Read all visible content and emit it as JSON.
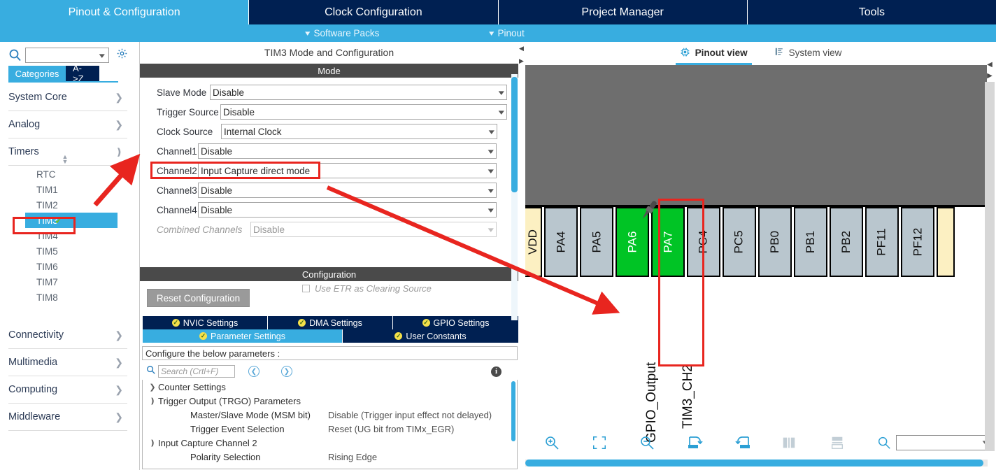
{
  "top_tabs": [
    {
      "label": "Pinout & Configuration",
      "active": true
    },
    {
      "label": "Clock Configuration",
      "active": false
    },
    {
      "label": "Project Manager",
      "active": false
    },
    {
      "label": "Tools",
      "active": false
    }
  ],
  "sub_bar": {
    "software_packs": "Software Packs",
    "pinout": "Pinout"
  },
  "sidebar": {
    "search_value": "",
    "search_icon": "search-icon",
    "gear_icon": "gear-icon",
    "toggle": {
      "categories": "Categories",
      "a_to_z": "A->Z"
    },
    "categories": [
      {
        "label": "System Core",
        "expanded": false
      },
      {
        "label": "Analog",
        "expanded": false
      },
      {
        "label": "Timers",
        "expanded": true
      }
    ],
    "timers": [
      {
        "label": "RTC",
        "selected": false,
        "configured": false
      },
      {
        "label": "TIM1",
        "selected": false,
        "configured": false
      },
      {
        "label": "TIM2",
        "selected": false,
        "configured": false
      },
      {
        "label": "TIM3",
        "selected": true,
        "configured": true
      },
      {
        "label": "TIM4",
        "selected": false,
        "configured": false
      },
      {
        "label": "TIM5",
        "selected": false,
        "configured": false
      },
      {
        "label": "TIM6",
        "selected": false,
        "configured": false
      },
      {
        "label": "TIM7",
        "selected": false,
        "configured": false
      },
      {
        "label": "TIM8",
        "selected": false,
        "configured": false
      }
    ],
    "categories_bottom": [
      {
        "label": "Connectivity",
        "expanded": false
      },
      {
        "label": "Multimedia",
        "expanded": false
      },
      {
        "label": "Computing",
        "expanded": false
      },
      {
        "label": "Middleware",
        "expanded": false
      }
    ]
  },
  "middle": {
    "title": "TIM3 Mode and Configuration",
    "mode_header": "Mode",
    "mode_fields": [
      {
        "label": "Slave Mode",
        "value": "Disable",
        "disabled": false,
        "highlight": false
      },
      {
        "label": "Trigger Source",
        "value": "Disable",
        "disabled": false,
        "highlight": false
      },
      {
        "label": "Clock Source",
        "value": "Internal Clock",
        "disabled": false,
        "highlight": false
      },
      {
        "label": "Channel1",
        "value": "Disable",
        "disabled": false,
        "highlight": false
      },
      {
        "label": "Channel2",
        "value": "Input Capture direct mode",
        "disabled": false,
        "highlight": true
      },
      {
        "label": "Channel3",
        "value": "Disable",
        "disabled": false,
        "highlight": false
      },
      {
        "label": "Channel4",
        "value": "Disable",
        "disabled": false,
        "highlight": false
      },
      {
        "label": "Combined Channels",
        "value": "Disable",
        "disabled": true,
        "highlight": false
      }
    ],
    "etr_checkbox": {
      "label": "Use ETR as Clearing Source",
      "checked": false
    },
    "configuration_header": "Configuration",
    "reset_button": "Reset Configuration",
    "config_tabs_row1": [
      {
        "label": "NVIC Settings",
        "active": false
      },
      {
        "label": "DMA Settings",
        "active": false
      },
      {
        "label": "GPIO Settings",
        "active": false
      }
    ],
    "config_tabs_row2": [
      {
        "label": "Parameter Settings",
        "active": true
      },
      {
        "label": "User Constants",
        "active": false
      }
    ],
    "configure_bar": "Configure the below parameters :",
    "search_placeholder": "Search (Crtl+F)",
    "search_value": "",
    "nav_prev_icon": "chevron-left-circle-icon",
    "nav_next_icon": "chevron-right-circle-icon",
    "info_icon": "info-icon",
    "param_tree": [
      {
        "indent": 0,
        "arrow": "collapsed",
        "name": "Counter Settings",
        "value": ""
      },
      {
        "indent": 0,
        "arrow": "expanded",
        "name": "Trigger Output (TRGO) Parameters",
        "value": ""
      },
      {
        "indent": 2,
        "arrow": "none",
        "name": "Master/Slave Mode (MSM bit)",
        "value": "Disable (Trigger input effect not delayed)"
      },
      {
        "indent": 2,
        "arrow": "none",
        "name": "Trigger Event Selection",
        "value": "Reset (UG bit from TIMx_EGR)"
      },
      {
        "indent": 0,
        "arrow": "expanded",
        "name": "Input Capture Channel 2",
        "value": ""
      },
      {
        "indent": 2,
        "arrow": "none",
        "name": "Polarity Selection",
        "value": "Rising Edge"
      }
    ]
  },
  "pinout": {
    "view_tabs": [
      {
        "label": "Pinout view",
        "active": true,
        "icon": "chip-icon"
      },
      {
        "label": "System view",
        "active": false,
        "icon": "list-icon"
      }
    ],
    "pins": [
      {
        "name": "VDD",
        "type": "vdd",
        "partial": true
      },
      {
        "name": "PA4",
        "type": "gray",
        "partial": false
      },
      {
        "name": "PA5",
        "type": "gray",
        "partial": false
      },
      {
        "name": "PA6",
        "type": "green",
        "partial": false
      },
      {
        "name": "PA7",
        "type": "green",
        "partial": false,
        "highlight": true
      },
      {
        "name": "PC4",
        "type": "gray",
        "partial": false
      },
      {
        "name": "PC5",
        "type": "gray",
        "partial": false
      },
      {
        "name": "PB0",
        "type": "gray",
        "partial": false
      },
      {
        "name": "PB1",
        "type": "gray",
        "partial": false
      },
      {
        "name": "PB2",
        "type": "gray",
        "partial": false
      },
      {
        "name": "PF11",
        "type": "gray",
        "partial": false
      },
      {
        "name": "PF12",
        "type": "gray",
        "partial": false
      },
      {
        "name": "",
        "type": "vdd",
        "partial": true
      }
    ],
    "signal_labels": [
      {
        "text": "GPIO_Output",
        "pin": "PA6",
        "highlight": false
      },
      {
        "text": "TIM3_CH2",
        "pin": "PA7",
        "highlight": true
      }
    ],
    "toolbar": [
      {
        "icon": "zoom-in-icon",
        "name": "zoom-in"
      },
      {
        "icon": "fit-icon",
        "name": "fit-to-screen"
      },
      {
        "icon": "zoom-out-icon",
        "name": "zoom-out"
      },
      {
        "icon": "rotate-right-icon",
        "name": "rotate-right"
      },
      {
        "icon": "rotate-left-icon",
        "name": "rotate-left"
      },
      {
        "icon": "flip-h-icon",
        "name": "flip-horizontal"
      },
      {
        "icon": "flip-v-icon",
        "name": "flip-vertical"
      },
      {
        "icon": "search-icon",
        "name": "pin-search"
      }
    ],
    "zoom_value": ""
  },
  "colors": {
    "brand_blue": "#38ade0",
    "dark_navy": "#002052",
    "annotation_red": "#e8251f",
    "pin_green": "#00c425",
    "pin_gray": "#b9c6ce",
    "pin_vdd": "#fcf0c2",
    "chip_body": "#6e6e6e"
  }
}
